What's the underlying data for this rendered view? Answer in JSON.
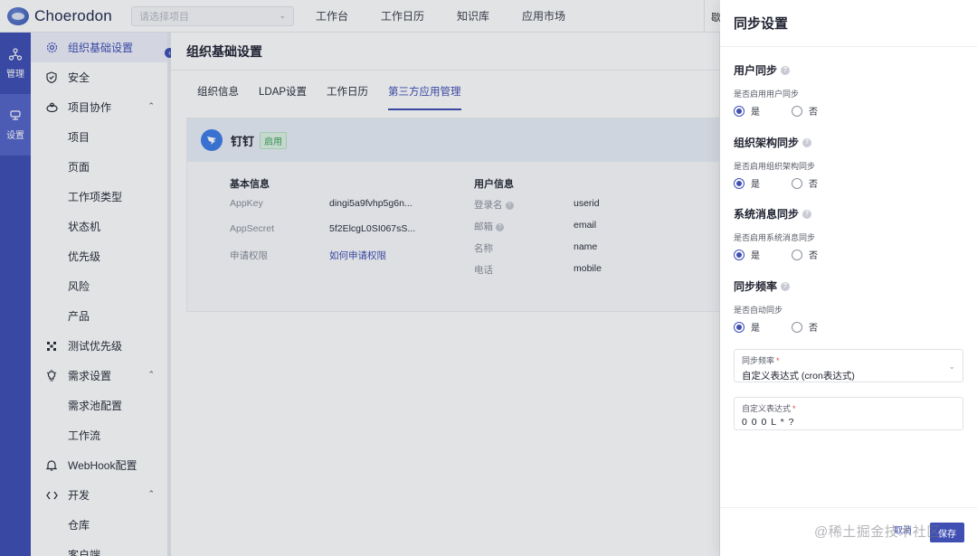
{
  "header": {
    "brand": "Choerodon",
    "project_placeholder": "请选择项目",
    "nav": [
      "工作台",
      "工作日历",
      "知识库",
      "应用市场"
    ],
    "right_text": "歇"
  },
  "rail": [
    {
      "label": "管理",
      "icon": "org-icon"
    },
    {
      "label": "设置",
      "icon": "settings-icon"
    }
  ],
  "menu": {
    "items": [
      {
        "label": "组织基础设置",
        "icon": "gear-icon",
        "level": 1,
        "active": true
      },
      {
        "label": "安全",
        "icon": "shield-icon",
        "level": 1
      },
      {
        "label": "项目协作",
        "icon": "collab-icon",
        "level": 1,
        "expanded": true
      },
      {
        "label": "项目",
        "level": 2
      },
      {
        "label": "页面",
        "level": 2
      },
      {
        "label": "工作项类型",
        "level": 2
      },
      {
        "label": "状态机",
        "level": 2
      },
      {
        "label": "优先级",
        "level": 2
      },
      {
        "label": "风险",
        "level": 2
      },
      {
        "label": "产品",
        "level": 2
      },
      {
        "label": "测试优先级",
        "icon": "grid-icon",
        "level": 1
      },
      {
        "label": "需求设置",
        "icon": "bulb-icon",
        "level": 1,
        "expanded": true
      },
      {
        "label": "需求池配置",
        "level": 2
      },
      {
        "label": "工作流",
        "level": 2
      },
      {
        "label": "WebHook配置",
        "icon": "bell-icon",
        "level": 1
      },
      {
        "label": "开发",
        "icon": "code-icon",
        "level": 1,
        "expanded": true
      },
      {
        "label": "仓库",
        "level": 2
      },
      {
        "label": "客户端",
        "level": 2
      }
    ]
  },
  "content": {
    "title": "组织基础设置",
    "tabs": [
      "组织信息",
      "LDAP设置",
      "工作日历",
      "第三方应用管理"
    ],
    "active_tab": 3,
    "app": {
      "name": "钉钉",
      "status": "启用",
      "basic_title": "基本信息",
      "basic": [
        {
          "key": "AppKey",
          "value": "dingi5a9fvhp5g6n..."
        },
        {
          "key": "AppSecret",
          "value": "5f2ElcgL0SI067sS..."
        },
        {
          "key": "申请权限",
          "value": "如何申请权限"
        }
      ],
      "user_title": "用户信息",
      "user": [
        {
          "key": "登录名",
          "value": "userid"
        },
        {
          "key": "邮箱",
          "value": "email"
        },
        {
          "key": "名称",
          "value": "name"
        },
        {
          "key": "电话",
          "value": "mobile"
        }
      ]
    }
  },
  "drawer": {
    "title": "同步设置",
    "groups": [
      {
        "title": "用户同步",
        "desc": "是否启用用户同步",
        "yes": "是",
        "no": "否"
      },
      {
        "title": "组织架构同步",
        "desc": "是否启用组织架构同步",
        "yes": "是",
        "no": "否"
      },
      {
        "title": "系统消息同步",
        "desc": "是否启用系统消息同步",
        "yes": "是",
        "no": "否"
      },
      {
        "title": "同步频率",
        "desc": "是否自动同步",
        "yes": "是",
        "no": "否"
      }
    ],
    "freq_field": {
      "label": "同步频率",
      "value": "自定义表达式 (cron表达式)"
    },
    "cron_field": {
      "label": "自定义表达式",
      "value": "0 0 0 L * ?"
    },
    "cancel_label": "取消",
    "save_label": "保存"
  },
  "watermark": "@稀土掘金技术社区",
  "colors": {
    "primary": "#3f4fb3",
    "rail": "#3f4fb3",
    "success": "#3aa35a"
  }
}
